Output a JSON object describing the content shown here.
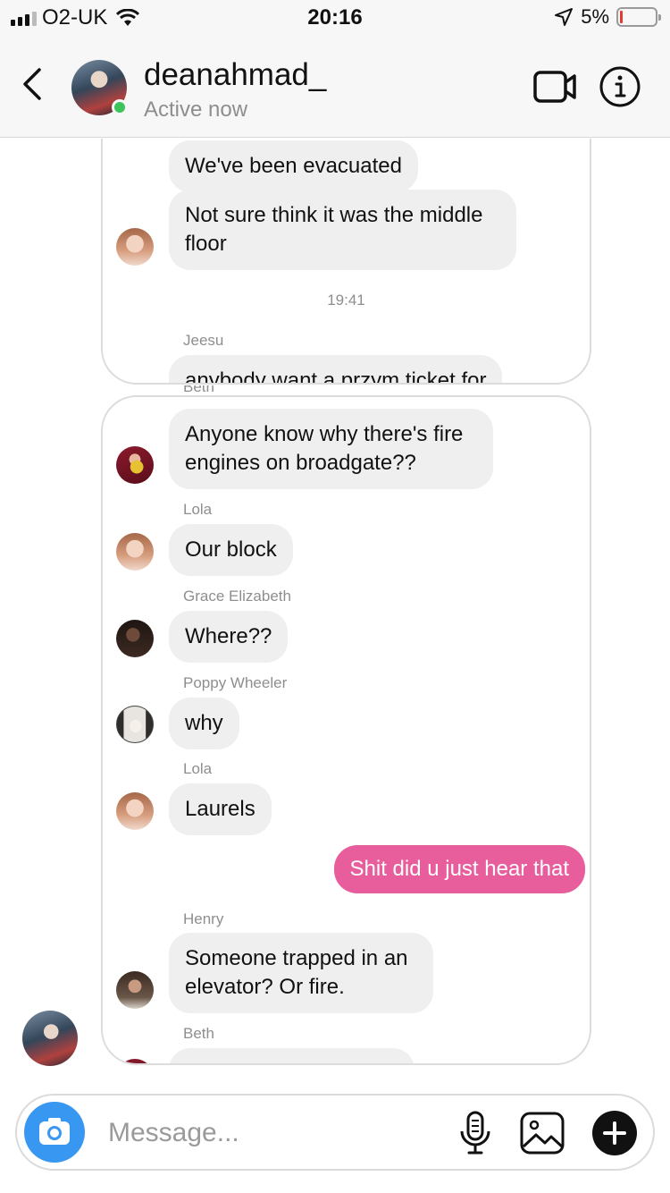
{
  "status_bar": {
    "carrier": "O2-UK",
    "time": "20:16",
    "battery_percent": "5%"
  },
  "header": {
    "username": "deanahmad_",
    "status": "Active now"
  },
  "shared_thread_1": {
    "messages": [
      {
        "text": "We've been evacuated"
      },
      {
        "text": "Not sure think it was the middle floor"
      }
    ],
    "timestamp": "19:41",
    "last_sender": "Jeesu",
    "last_message_partial": "anybody want a przym ticket for",
    "next_sender_partial": "Beth"
  },
  "shared_thread_2": {
    "messages": [
      {
        "sender": "",
        "text": "Anyone know why there's fire engines on broadgate??"
      },
      {
        "sender": "Lola",
        "text": "Our block"
      },
      {
        "sender": "Grace Elizabeth",
        "text": "Where??"
      },
      {
        "sender": "Poppy Wheeler",
        "text": "why"
      },
      {
        "sender": "Lola",
        "text": "Laurels"
      },
      {
        "sender": "Henry",
        "text": "Someone trapped in an elevator? Or fire."
      },
      {
        "sender": "Beth",
        "text": ""
      }
    ]
  },
  "my_message": {
    "text": "Shit did u just hear that"
  },
  "composer": {
    "placeholder": "Message..."
  },
  "colors": {
    "accent_blue": "#3897f0",
    "my_bubble": "#e85d9c",
    "online": "#3ec25a"
  }
}
